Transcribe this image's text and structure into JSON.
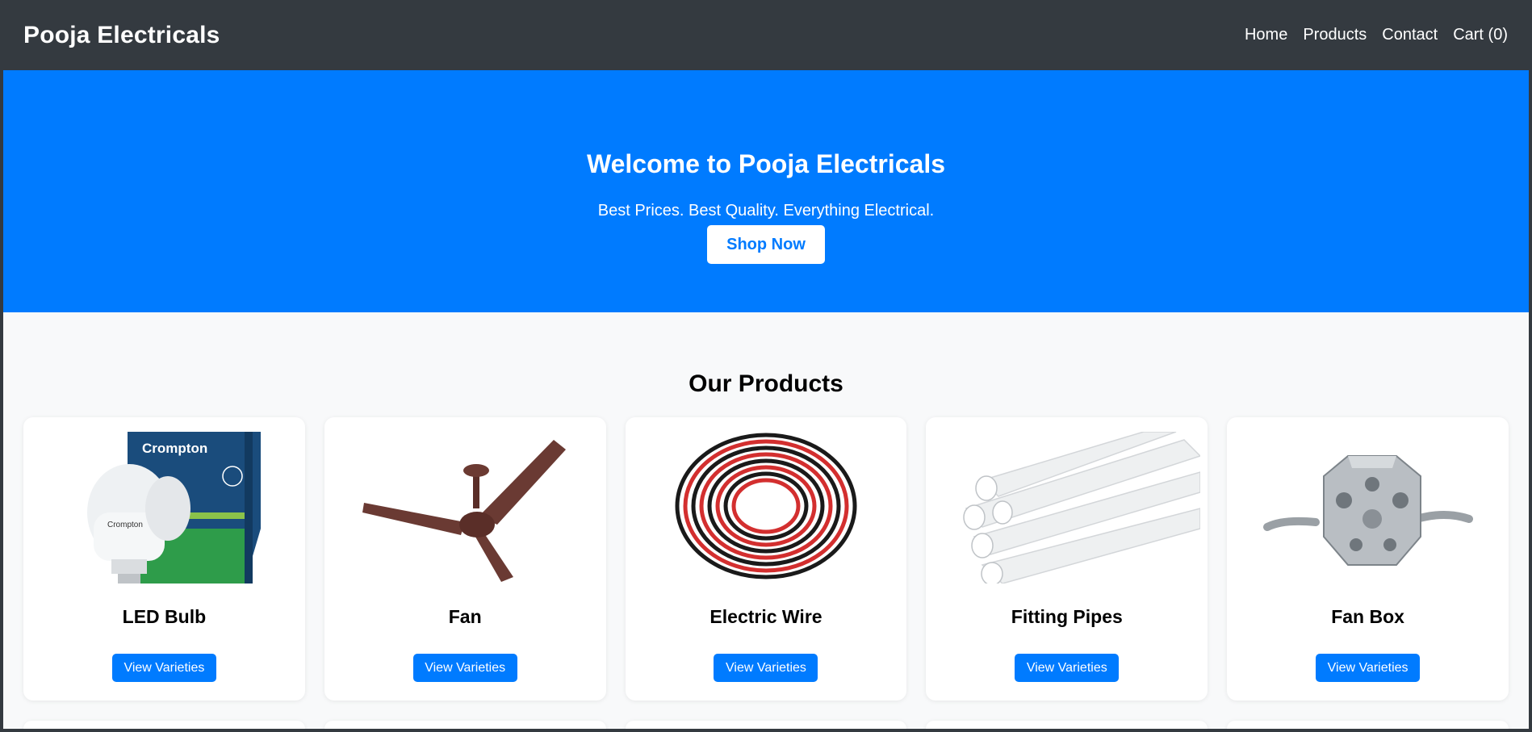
{
  "nav": {
    "brand": "Pooja Electricals",
    "links": [
      "Home",
      "Products",
      "Contact",
      "Cart (0)"
    ]
  },
  "hero": {
    "title": "Welcome to Pooja Electricals",
    "tagline": "Best Prices. Best Quality. Everything Electrical.",
    "cta": "Shop Now"
  },
  "products": {
    "heading": "Our Products",
    "items": [
      {
        "name": "LED Bulb",
        "button": "View Varieties",
        "image": "led-bulb-image"
      },
      {
        "name": "Fan",
        "button": "View Varieties",
        "image": "ceiling-fan-image"
      },
      {
        "name": "Electric Wire",
        "button": "View Varieties",
        "image": "electric-wire-image"
      },
      {
        "name": "Fitting Pipes",
        "button": "View Varieties",
        "image": "fitting-pipes-image"
      },
      {
        "name": "Fan Box",
        "button": "View Varieties",
        "image": "fan-box-image"
      }
    ]
  },
  "colors": {
    "navbar": "#343a40",
    "primary": "#007bff",
    "background": "#f8f9fa"
  }
}
